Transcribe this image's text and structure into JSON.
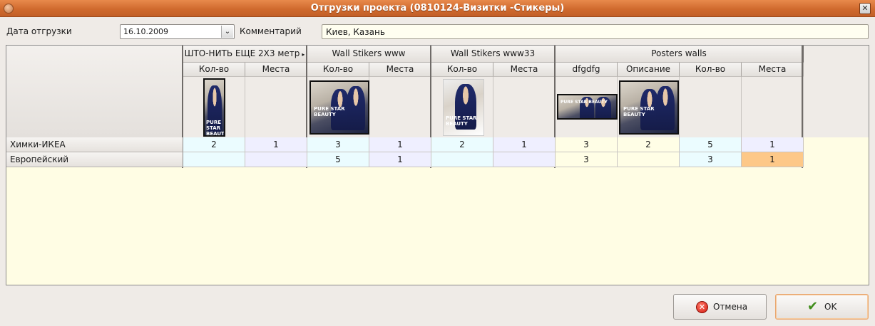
{
  "window": {
    "title": "Отгрузки проекта (0810124-Визитки -Стикеры)",
    "close_glyph": "✕"
  },
  "form": {
    "date_label": "Дата отгрузки",
    "date_value": "16.10.2009",
    "comment_label": "Комментарий",
    "comment_value": "Киев, Казань"
  },
  "grid": {
    "groups": [
      {
        "label": "ШТО-НИТЬ ЕЩЕ 2Х3 метр",
        "columns": [
          "Кол-во",
          "Места"
        ]
      },
      {
        "label": "Wall Stikers www",
        "columns": [
          "Кол-во",
          "Места"
        ]
      },
      {
        "label": "Wall Stikers www33",
        "columns": [
          "Кол-во",
          "Места"
        ]
      },
      {
        "label": "Posters walls",
        "columns": [
          "dfgdfg",
          "Описание",
          "Кол-во",
          "Места"
        ]
      }
    ],
    "overflow_icon": "triangle-right-icon",
    "thumb_text": "PURE STAR BEAUTY",
    "rows": [
      {
        "name": "Химки-ИКЕА",
        "cells": [
          "2",
          "1",
          "3",
          "1",
          "2",
          "1",
          "3",
          "2",
          "5",
          "1"
        ]
      },
      {
        "name": "Европейский",
        "cells": [
          "",
          "",
          "5",
          "1",
          "",
          "",
          "3",
          "",
          "3",
          "1"
        ]
      }
    ],
    "colors": {
      "qty_cell": "#ebfcff",
      "places_cell": "#efefff",
      "text_cell": "#fffee6",
      "selected_cell": "#fdc888"
    }
  },
  "buttons": {
    "cancel_label": "Отмена",
    "ok_label": "OK",
    "cancel_icon": "cancel-icon",
    "ok_icon": "checkmark-icon"
  }
}
